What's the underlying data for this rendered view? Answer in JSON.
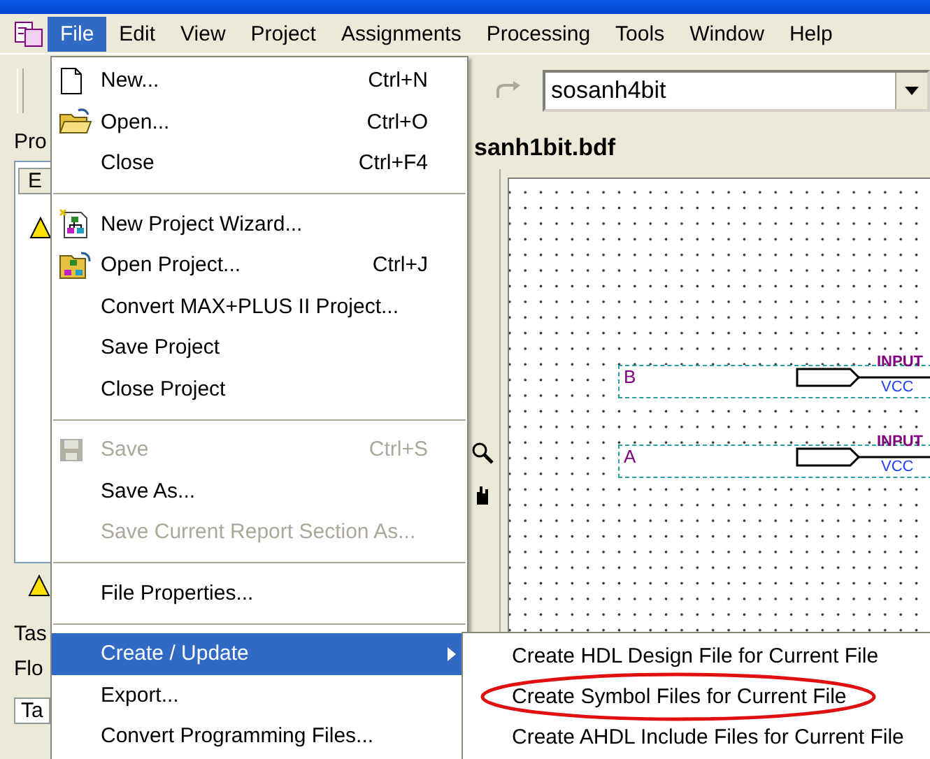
{
  "menubar": [
    {
      "label": "File",
      "selected": true
    },
    {
      "label": "Edit",
      "selected": false
    },
    {
      "label": "View",
      "selected": false
    },
    {
      "label": "Project",
      "selected": false
    },
    {
      "label": "Assignments",
      "selected": false
    },
    {
      "label": "Processing",
      "selected": false
    },
    {
      "label": "Tools",
      "selected": false
    },
    {
      "label": "Window",
      "selected": false
    },
    {
      "label": "Help",
      "selected": false
    }
  ],
  "toolbar": {
    "entity_combo": {
      "value": "sosanh4bit"
    }
  },
  "left_panel": {
    "title": "Pro",
    "tab": "E",
    "tasks_title": "Tas",
    "flow_label": "Flo",
    "bottom_tab": "Ta"
  },
  "editor": {
    "title": "sanh1bit.bdf",
    "pins": [
      {
        "name": "B",
        "type": "INPUT",
        "default": "VCC"
      },
      {
        "name": "A",
        "type": "INPUT",
        "default": "VCC"
      }
    ]
  },
  "file_menu": [
    {
      "kind": "item",
      "label": "New...",
      "shortcut": "Ctrl+N",
      "disabled": false,
      "selected": false
    },
    {
      "kind": "item",
      "label": "Open...",
      "shortcut": "Ctrl+O",
      "disabled": false,
      "selected": false
    },
    {
      "kind": "item",
      "label": "Close",
      "shortcut": "Ctrl+F4",
      "disabled": false,
      "selected": false
    },
    {
      "kind": "separator"
    },
    {
      "kind": "item",
      "label": "New Project Wizard...",
      "disabled": false,
      "selected": false
    },
    {
      "kind": "item",
      "label": "Open Project...",
      "shortcut": "Ctrl+J",
      "disabled": false,
      "selected": false
    },
    {
      "kind": "item",
      "label": "Convert MAX+PLUS II Project...",
      "disabled": false,
      "selected": false
    },
    {
      "kind": "item",
      "label": "Save Project",
      "disabled": false,
      "selected": false
    },
    {
      "kind": "item",
      "label": "Close Project",
      "disabled": false,
      "selected": false
    },
    {
      "kind": "separator"
    },
    {
      "kind": "item",
      "label": "Save",
      "shortcut": "Ctrl+S",
      "disabled": true,
      "selected": false
    },
    {
      "kind": "item",
      "label": "Save As...",
      "disabled": false,
      "selected": false
    },
    {
      "kind": "item",
      "label": "Save Current Report Section As...",
      "disabled": true,
      "selected": false
    },
    {
      "kind": "separator"
    },
    {
      "kind": "item",
      "label": "File Properties...",
      "disabled": false,
      "selected": false
    },
    {
      "kind": "separator"
    },
    {
      "kind": "submenu",
      "label": "Create / Update",
      "disabled": false,
      "selected": true
    },
    {
      "kind": "item",
      "label": "Export...",
      "disabled": false,
      "selected": false
    },
    {
      "kind": "item",
      "label": "Convert Programming Files...",
      "disabled": false,
      "selected": false
    }
  ],
  "submenu": [
    {
      "label": "Create HDL Design File for Current File",
      "circled": false
    },
    {
      "label": "Create Symbol Files for Current File",
      "circled": true
    },
    {
      "label": "Create AHDL Include Files for Current File",
      "circled": false
    }
  ]
}
